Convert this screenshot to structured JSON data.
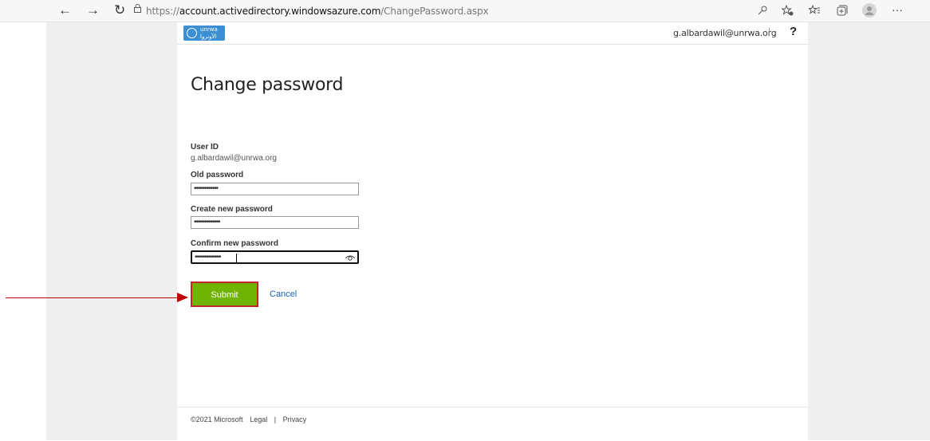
{
  "browser": {
    "url_prefix": "https://",
    "url_host": "account.activedirectory.windowsazure.com",
    "url_path": "/ChangePassword.aspx"
  },
  "header": {
    "logo_text_top": "unrwa",
    "logo_text_bottom": "الأونروا",
    "user_email": "g.albardawil@unrwa.org",
    "separator": "|",
    "help_label": "?"
  },
  "form": {
    "title": "Change password",
    "user_id_label": "User ID",
    "user_id_value": "g.albardawil@unrwa.org",
    "old_password_label": "Old password",
    "old_password_value": "••••••••••••",
    "new_password_label": "Create new password",
    "new_password_value": "•••••••••••••",
    "confirm_password_label": "Confirm new password",
    "confirm_password_value": "•••••••••••••",
    "submit_label": "Submit",
    "cancel_label": "Cancel"
  },
  "footer": {
    "copyright": "©2021 Microsoft",
    "legal": "Legal",
    "separator": "|",
    "privacy": "Privacy"
  },
  "colors": {
    "submit_bg": "#70b300",
    "highlight": "#c0262c",
    "link": "#1a5fb4"
  }
}
